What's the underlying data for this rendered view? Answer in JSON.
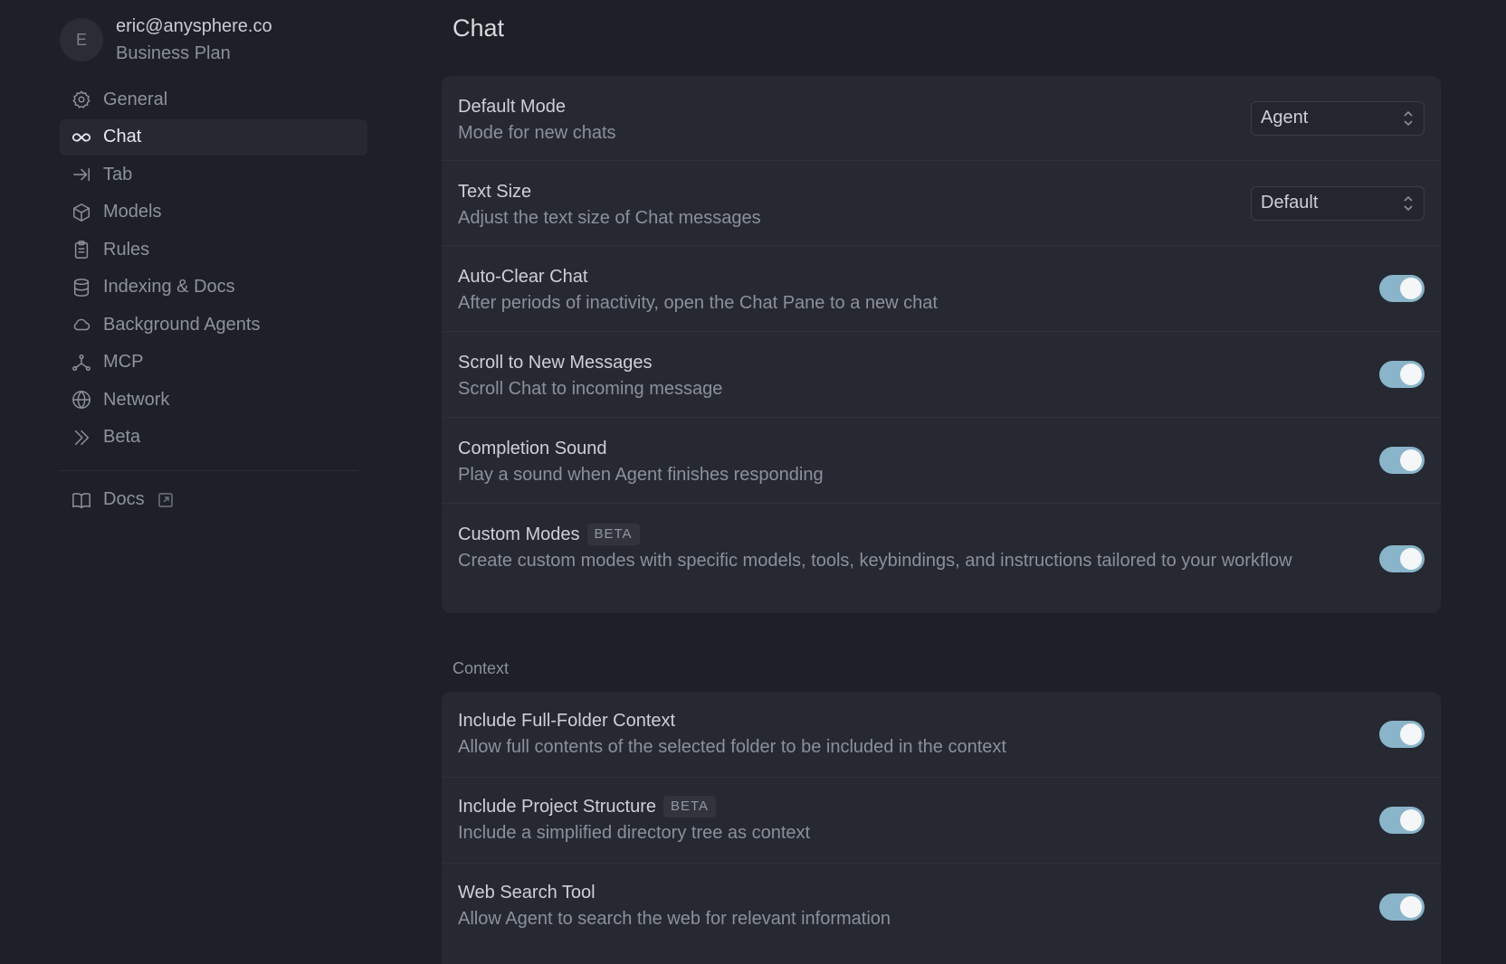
{
  "account": {
    "avatar_initial": "E",
    "email": "eric@anysphere.co",
    "plan": "Business Plan"
  },
  "sidebar": {
    "items": [
      {
        "label": "General",
        "icon": "gear-icon"
      },
      {
        "label": "Chat",
        "icon": "infinity-icon",
        "active": true
      },
      {
        "label": "Tab",
        "icon": "arrow-right-bar-icon"
      },
      {
        "label": "Models",
        "icon": "cube-icon"
      },
      {
        "label": "Rules",
        "icon": "clipboard-icon"
      },
      {
        "label": "Indexing & Docs",
        "icon": "database-icon"
      },
      {
        "label": "Background Agents",
        "icon": "cloud-icon"
      },
      {
        "label": "MCP",
        "icon": "nodes-icon"
      },
      {
        "label": "Network",
        "icon": "globe-icon"
      },
      {
        "label": "Beta",
        "icon": "double-chevron-icon"
      }
    ],
    "docs_label": "Docs"
  },
  "main": {
    "title": "Chat",
    "settings": [
      {
        "title": "Default Mode",
        "desc": "Mode for new chats",
        "control": "select",
        "value": "Agent"
      },
      {
        "title": "Text Size",
        "desc": "Adjust the text size of Chat messages",
        "control": "select",
        "value": "Default"
      },
      {
        "title": "Auto-Clear Chat",
        "desc": "After periods of inactivity, open the Chat Pane to a new chat",
        "control": "toggle",
        "on": true
      },
      {
        "title": "Scroll to New Messages",
        "desc": "Scroll Chat to incoming message",
        "control": "toggle",
        "on": true
      },
      {
        "title": "Completion Sound",
        "desc": "Play a sound when Agent finishes responding",
        "control": "toggle",
        "on": true
      },
      {
        "title": "Custom Modes",
        "badge": "BETA",
        "desc": "Create custom modes with specific models, tools, keybindings, and instructions tailored to your workflow",
        "control": "toggle",
        "on": true
      }
    ],
    "context_label": "Context",
    "context_settings": [
      {
        "title": "Include Full-Folder Context",
        "desc": "Allow full contents of the selected folder to be included in the context",
        "control": "toggle",
        "on": true
      },
      {
        "title": "Include Project Structure",
        "badge": "BETA",
        "desc": "Include a simplified directory tree as context",
        "control": "toggle",
        "on": true
      },
      {
        "title": "Web Search Tool",
        "desc": "Allow Agent to search the web for relevant information",
        "control": "toggle",
        "on": true
      }
    ]
  },
  "colors": {
    "background": "#1e2027",
    "card": "#262932",
    "toggle_on": "#89b4c9"
  }
}
